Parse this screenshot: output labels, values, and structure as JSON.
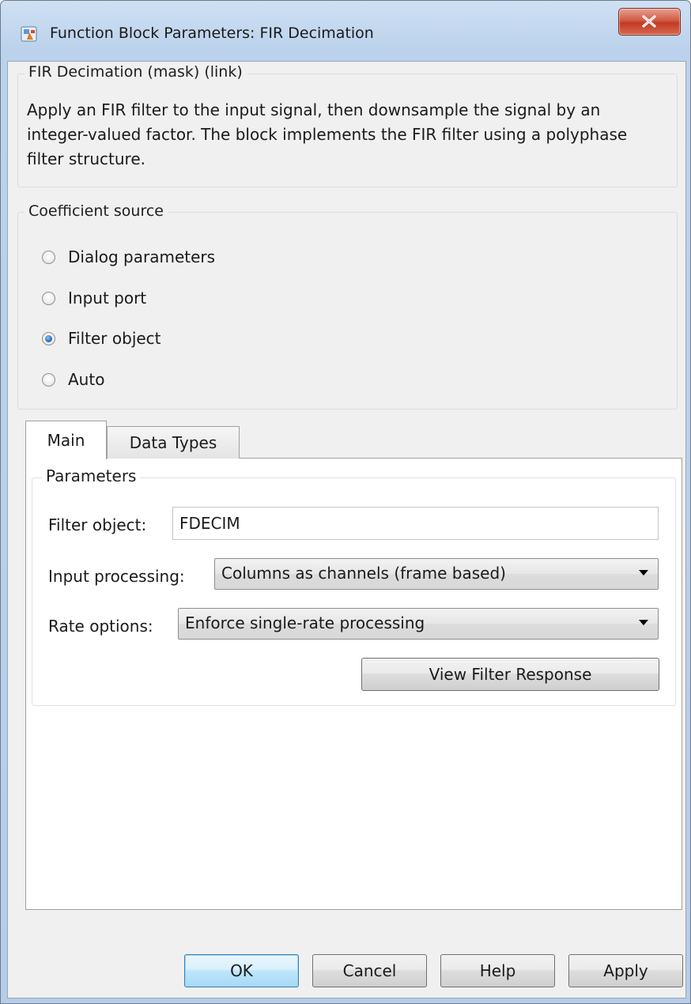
{
  "window": {
    "title": "Function Block Parameters: FIR Decimation"
  },
  "mask": {
    "legend": "FIR Decimation (mask) (link)",
    "description": "Apply an FIR filter to the input signal, then downsample the signal by an integer-valued factor. The block implements the FIR filter using a polyphase filter structure."
  },
  "coefficient_source": {
    "legend": "Coefficient source",
    "options": [
      {
        "label": "Dialog parameters",
        "checked": false
      },
      {
        "label": "Input port",
        "checked": false
      },
      {
        "label": "Filter object",
        "checked": true
      },
      {
        "label": "Auto",
        "checked": false
      }
    ]
  },
  "tabs": [
    {
      "label": "Main",
      "active": true
    },
    {
      "label": "Data Types",
      "active": false
    }
  ],
  "parameters": {
    "legend": "Parameters",
    "filter_object_label": "Filter object:",
    "filter_object_value": "FDECIM",
    "input_processing_label": "Input processing:",
    "input_processing_value": "Columns as channels (frame based)",
    "rate_options_label": "Rate options:",
    "rate_options_value": "Enforce single-rate processing",
    "view_filter_response_label": "View Filter Response"
  },
  "buttons": {
    "ok": "OK",
    "cancel": "Cancel",
    "help": "Help",
    "apply": "Apply"
  },
  "colors": {
    "titlebar": "#bcd2ec",
    "dialog_bg": "#f0f0f0",
    "close_button": "#c23a24",
    "radio_checked": "#2a6fc0",
    "default_button_border": "#3c7fb1"
  },
  "icons": {
    "app": "matlab-block-icon",
    "close": "close-icon",
    "dropdown": "chevron-down-icon"
  }
}
